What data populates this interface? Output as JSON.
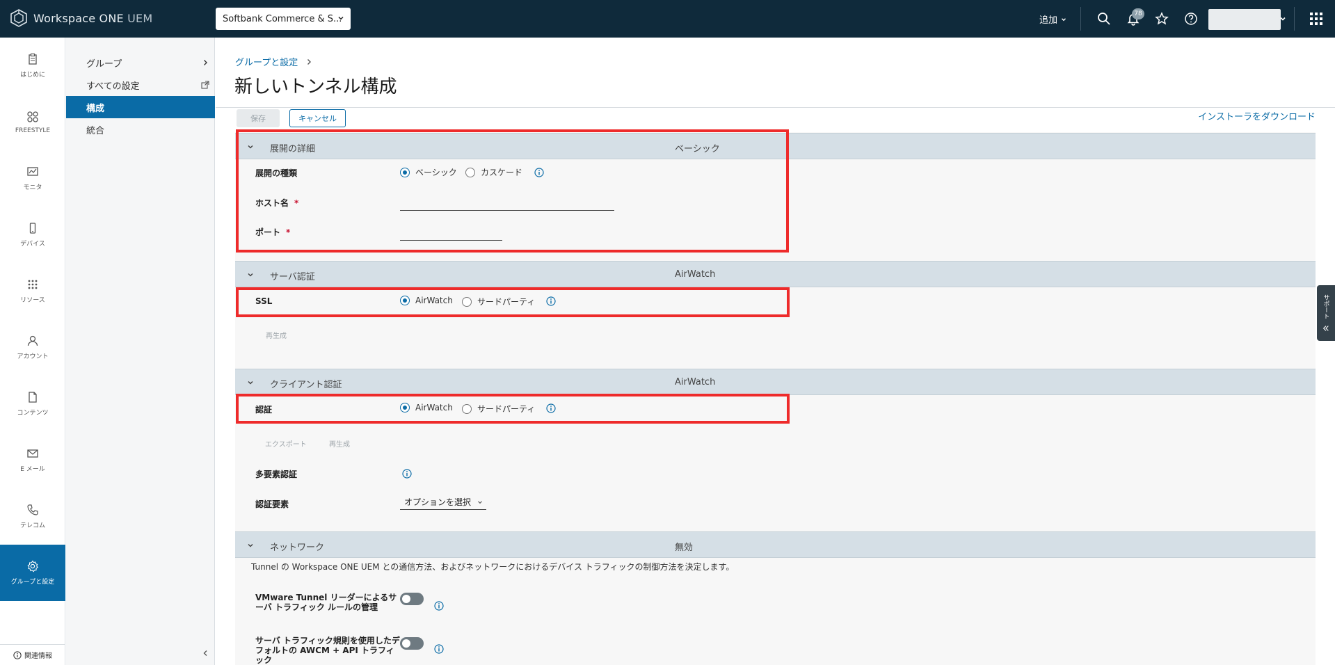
{
  "header": {
    "app_name": "Workspace ONE",
    "app_suffix": "UEM",
    "org_selector": "Softbank Commerce & S...",
    "add_label": "追加",
    "notification_count": "78",
    "icons": [
      "search-icon",
      "bell-icon",
      "star-icon",
      "help-icon",
      "apps-grid-icon"
    ]
  },
  "leftnav": {
    "items": [
      {
        "label": "はじめに",
        "icon": "clipboard-icon"
      },
      {
        "label": "FREESTYLE",
        "icon": "freestyle-icon"
      },
      {
        "label": "モニタ",
        "icon": "monitor-icon"
      },
      {
        "label": "デバイス",
        "icon": "device-icon"
      },
      {
        "label": "リソース",
        "icon": "resources-icon"
      },
      {
        "label": "アカウント",
        "icon": "account-icon"
      },
      {
        "label": "コンテンツ",
        "icon": "content-icon"
      },
      {
        "label": "E メール",
        "icon": "email-icon"
      },
      {
        "label": "テレコム",
        "icon": "phone-icon"
      },
      {
        "label": "グループと設定",
        "icon": "gear-icon"
      }
    ],
    "active_index": 9,
    "bottom_label": "関連情報"
  },
  "subnav": {
    "items": [
      {
        "label": "グループ"
      },
      {
        "label": "すべての設定"
      },
      {
        "label": "構成"
      },
      {
        "label": "統合"
      }
    ],
    "active_index": 2
  },
  "main": {
    "breadcrumb": "グループと設定",
    "title": "新しいトンネル構成",
    "save_label": "保存",
    "cancel_label": "キャンセル",
    "download_link": "インストーラをダウンロード",
    "sections": {
      "deployment": {
        "title": "展開の詳細",
        "summary": "ベーシック",
        "type_label": "展開の種類",
        "type_options": [
          "ベーシック",
          "カスケード"
        ],
        "type_selected": "ベーシック",
        "hostname_label": "ホスト名",
        "port_label": "ポート",
        "required_mark": "*"
      },
      "server_auth": {
        "title": "サーバ認証",
        "summary": "AirWatch",
        "ssl_label": "SSL",
        "options": [
          "AirWatch",
          "サードパーティ"
        ],
        "selected": "AirWatch",
        "regenerate": "再生成"
      },
      "client_auth": {
        "title": "クライアント認証",
        "summary": "AirWatch",
        "auth_label": "認証",
        "options": [
          "AirWatch",
          "サードパーティ"
        ],
        "selected": "AirWatch",
        "export": "エクスポート",
        "regenerate": "再生成",
        "mfa_label": "多要素認証",
        "factor_label": "認証要素",
        "factor_placeholder": "オプションを選択"
      },
      "network": {
        "title": "ネットワーク",
        "summary": "無効",
        "description": "Tunnel の Workspace ONE UEM との通信方法、およびネットワークにおけるデバイス トラフィックの制御方法を決定します。",
        "toggle1_label": "VMware Tunnel リーダーによるサーバ トラフィック ルールの管理",
        "toggle2_label": "サーバ トラフィック規則を使用したデフォルトの AWCM + API トラフィック"
      }
    }
  },
  "support_tab": "サポート",
  "colors": {
    "header_bg": "#0f2a3b",
    "accent": "#0a6ba6",
    "highlight": "#ee2b2b",
    "section_bg": "#d5dfe6"
  }
}
